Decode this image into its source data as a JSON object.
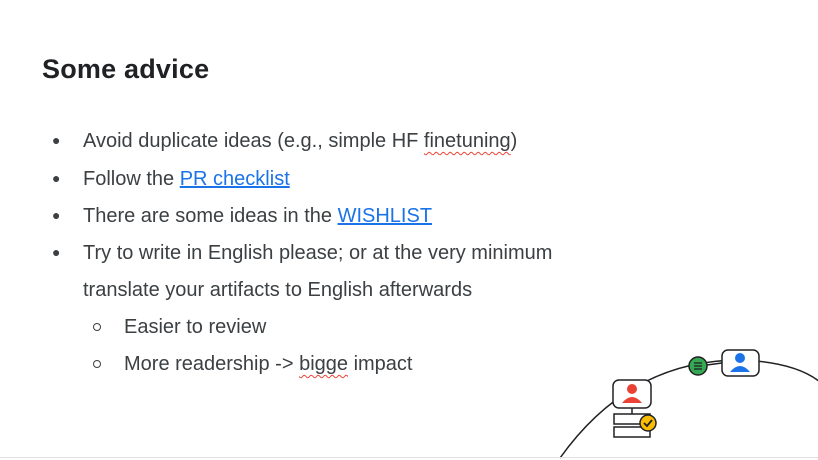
{
  "slide": {
    "title": "Some advice",
    "bullets": [
      {
        "pre": "Avoid duplicate ideas (e.g., simple HF ",
        "flagged": "finetuning",
        "post": ")"
      },
      {
        "pre": "Follow the ",
        "link": "PR checklist"
      },
      {
        "pre": "There are some ideas in the ",
        "link": "WISHLIST"
      },
      {
        "line1": "Try to write in English please; or at the very minimum",
        "line2": "translate your artifacts to English afterwards"
      }
    ],
    "sub_bullets": [
      {
        "text": "Easier to review"
      },
      {
        "pre": "More readership -> ",
        "flagged": "bigge",
        "post": " impact"
      }
    ]
  },
  "colors": {
    "text": "#3c4043",
    "link": "#1a73e8",
    "red": "#ea4335",
    "green": "#34a853",
    "blue": "#1a73e8",
    "yellow": "#fbbc04"
  },
  "icons": [
    "person-card-red-icon",
    "person-card-blue-icon",
    "chat-bubble-green-icon",
    "checkmark-badge-yellow-icon"
  ]
}
